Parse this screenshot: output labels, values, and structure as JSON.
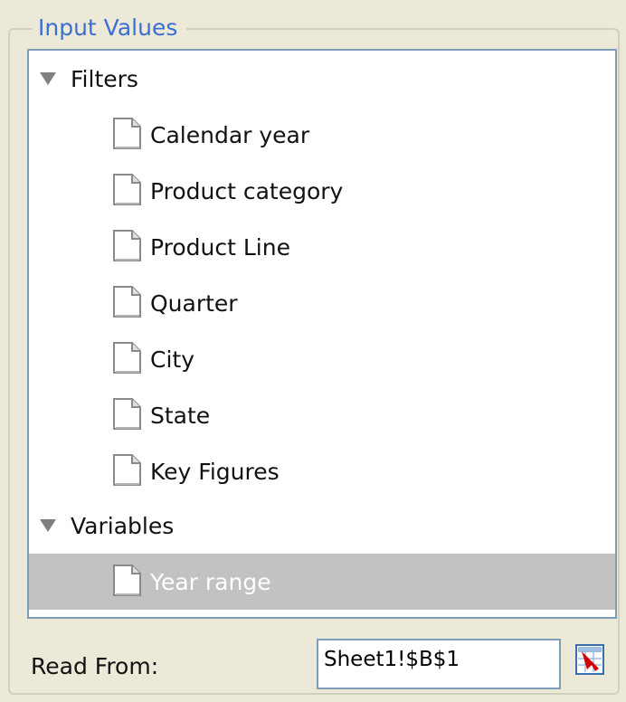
{
  "groupbox": {
    "title": "Input Values"
  },
  "tree": {
    "groups": [
      {
        "label": "Filters",
        "expanded": true,
        "items": [
          {
            "label": "Calendar year",
            "selected": false
          },
          {
            "label": "Product category",
            "selected": false
          },
          {
            "label": "Product Line",
            "selected": false
          },
          {
            "label": "Quarter",
            "selected": false
          },
          {
            "label": "City",
            "selected": false
          },
          {
            "label": "State",
            "selected": false
          },
          {
            "label": "Key Figures",
            "selected": false
          }
        ]
      },
      {
        "label": "Variables",
        "expanded": true,
        "items": [
          {
            "label": "Year range",
            "selected": true
          }
        ]
      }
    ]
  },
  "read_from": {
    "label": "Read From:",
    "value": "Sheet1!$B$1"
  },
  "icons": {
    "expander": "triangle-down-icon",
    "leaf": "document-icon",
    "range_button": "range-select-icon"
  },
  "colors": {
    "title": "#3C6FD3",
    "selection": "#C2C2C2",
    "window": "#ECE9D8",
    "border": "#7F9DB9"
  }
}
